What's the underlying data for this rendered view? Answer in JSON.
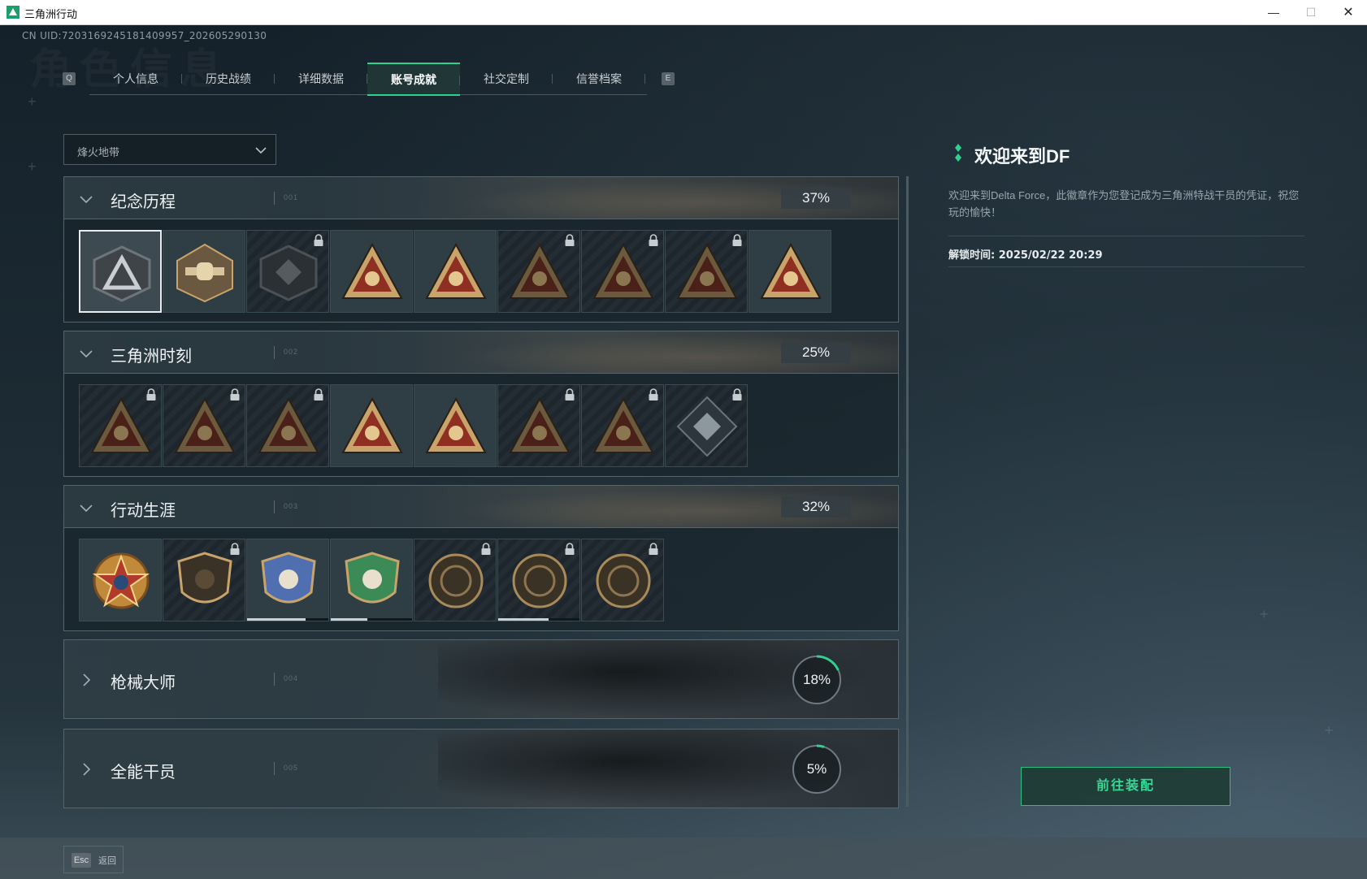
{
  "window": {
    "title": "三角洲行动",
    "minimize": "—",
    "maximize": "☐",
    "close": "✕"
  },
  "header": {
    "uid": "CN UID:7203169245181409957_202605290130",
    "ghost_title": "角色信息",
    "key_left": "Q",
    "key_right": "E",
    "tabs": [
      {
        "label": "个人信息"
      },
      {
        "label": "历史战绩"
      },
      {
        "label": "详细数据"
      },
      {
        "label": "账号成就",
        "active": true
      },
      {
        "label": "社交定制"
      },
      {
        "label": "信誉档案"
      }
    ]
  },
  "filter": {
    "selected": "烽火地带",
    "icon": "chevron-down-icon"
  },
  "categories": [
    {
      "name": "纪念历程",
      "number": "001",
      "percent": "37%",
      "expanded": true,
      "badges": [
        {
          "icon": "delta-emblem-icon",
          "locked": false,
          "selected": true
        },
        {
          "icon": "helicopter-badge-icon",
          "locked": false
        },
        {
          "icon": "shield-emblem-icon",
          "locked": true
        },
        {
          "icon": "s7-triangle-badge-icon",
          "locked": false
        },
        {
          "icon": "s8-triangle-badge-icon",
          "locked": false
        },
        {
          "icon": "armored-triangle-badge-icon",
          "locked": true
        },
        {
          "icon": "operator-triangle-badge-icon",
          "locked": true
        },
        {
          "icon": "skull-triangle-badge-icon",
          "locked": true
        },
        {
          "icon": "number-one-triangle-badge-icon",
          "locked": false
        }
      ]
    },
    {
      "name": "三角洲时刻",
      "number": "002",
      "percent": "25%",
      "expanded": true,
      "badges": [
        {
          "icon": "crate-triangle-badge-icon",
          "locked": true
        },
        {
          "icon": "medkit-triangle-badge-icon",
          "locked": true
        },
        {
          "icon": "runner-triangle-badge-icon",
          "locked": true
        },
        {
          "icon": "gem-triangle-badge-icon",
          "locked": false
        },
        {
          "icon": "squad-triangle-badge-icon",
          "locked": false
        },
        {
          "icon": "beast-triangle-badge-icon",
          "locked": true
        },
        {
          "icon": "fish-triangle-badge-icon",
          "locked": true
        },
        {
          "icon": "cube-diamond-badge-icon",
          "locked": true
        }
      ]
    },
    {
      "name": "行动生涯",
      "number": "003",
      "percent": "32%",
      "expanded": true,
      "badges": [
        {
          "icon": "star-medal-icon",
          "locked": false
        },
        {
          "icon": "rank-shield-icon",
          "locked": true
        },
        {
          "icon": "blue-shield-icon",
          "locked": false,
          "progress": 0.72
        },
        {
          "icon": "green-shield-icon",
          "locked": false,
          "progress": 0.45
        },
        {
          "icon": "helmet-coin-icon",
          "locked": true
        },
        {
          "icon": "skull-coin-icon",
          "locked": true,
          "progress": 0.62
        },
        {
          "icon": "eye-coin-icon",
          "locked": true
        }
      ]
    },
    {
      "name": "枪械大师",
      "number": "004",
      "percent": "18%",
      "progress": 0.18,
      "expanded": false
    },
    {
      "name": "全能干员",
      "number": "005",
      "percent": "5%",
      "progress": 0.05,
      "expanded": false
    }
  ],
  "detail": {
    "title": "欢迎来到DF",
    "description": "欢迎来到Delta Force，此徽章作为您登记成为三角洲特战干员的凭证，祝您玩的愉快！",
    "unlock_time": "解锁时间: 2025/02/22 20:29",
    "equip_button": "前往装配"
  },
  "footer": {
    "esc_key": "Esc",
    "esc_label": "返回"
  },
  "colors": {
    "accent": "#2ed18e",
    "badge_gold": "#c9a46a",
    "badge_red": "#8e2f22"
  }
}
